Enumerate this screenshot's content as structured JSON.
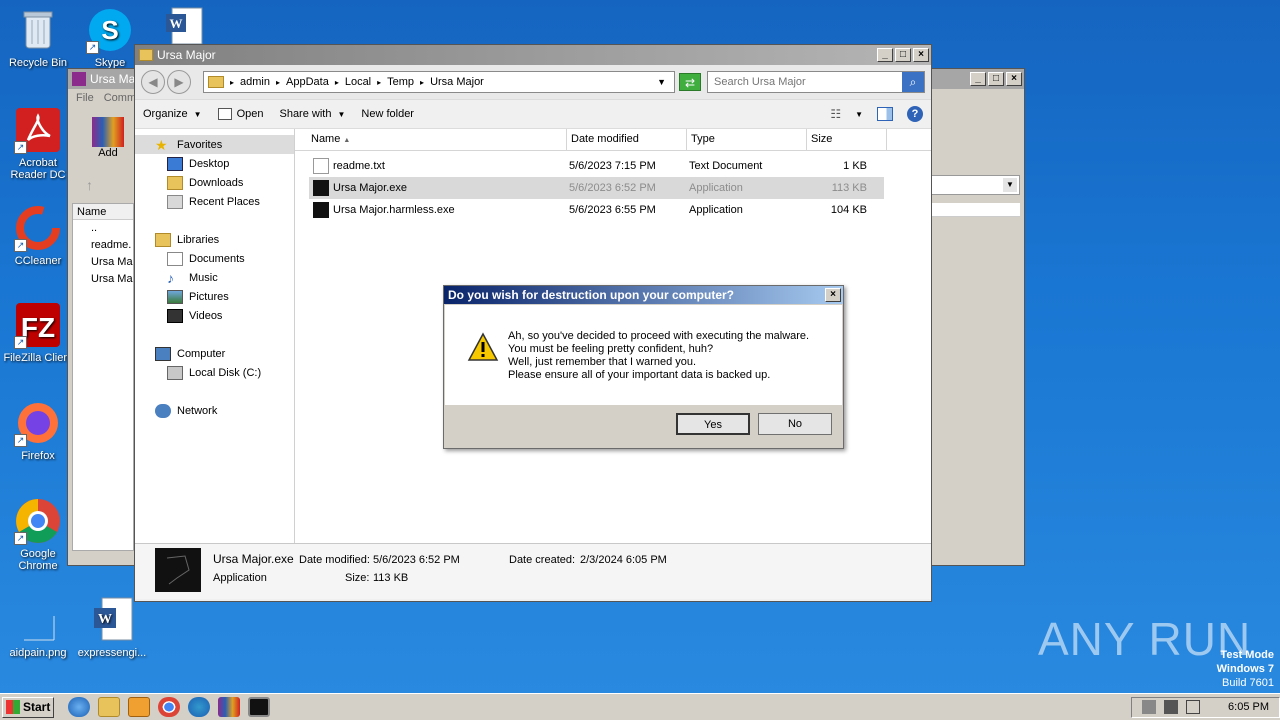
{
  "desktop_icons": [
    {
      "label": "Recycle Bin",
      "icon": "recycle-bin-icon"
    },
    {
      "label": "Skype",
      "icon": "skype-icon"
    },
    {
      "label": "Acrobat Reader DC",
      "icon": "acrobat-icon"
    },
    {
      "label": "CCleaner",
      "icon": "ccleaner-icon"
    },
    {
      "label": "FileZilla Client",
      "icon": "filezilla-icon"
    },
    {
      "label": "Firefox",
      "icon": "firefox-icon"
    },
    {
      "label": "Google Chrome",
      "icon": "chrome-icon"
    },
    {
      "label": "aidpain.png",
      "icon": "image-file-icon"
    },
    {
      "label": "expressengi...",
      "icon": "word-doc-icon"
    }
  ],
  "back_window": {
    "title": "Ursa Ma",
    "menu_file": "File",
    "menu_comm": "Comm",
    "add_label": "Add",
    "col_name": "Name",
    "rows": [
      "..",
      "readme.",
      "Ursa Ma",
      "Ursa Ma"
    ]
  },
  "explorer": {
    "title": "Ursa Major",
    "breadcrumb": [
      "admin",
      "AppData",
      "Local",
      "Temp",
      "Ursa Major"
    ],
    "search_placeholder": "Search Ursa Major",
    "toolbar": {
      "organize": "Organize",
      "open": "Open",
      "share_with": "Share with",
      "new_folder": "New folder"
    },
    "nav": {
      "favorites": "Favorites",
      "favorites_items": [
        "Desktop",
        "Downloads",
        "Recent Places"
      ],
      "libraries": "Libraries",
      "libraries_items": [
        "Documents",
        "Music",
        "Pictures",
        "Videos"
      ],
      "computer": "Computer",
      "computer_items": [
        "Local Disk (C:)"
      ],
      "network": "Network"
    },
    "columns": {
      "name": "Name",
      "date": "Date modified",
      "type": "Type",
      "size": "Size"
    },
    "files": [
      {
        "name": "readme.txt",
        "date": "5/6/2023 7:15 PM",
        "type": "Text Document",
        "size": "1 KB"
      },
      {
        "name": "Ursa Major.exe",
        "date": "5/6/2023 6:52 PM",
        "type": "Application",
        "size": "113 KB"
      },
      {
        "name": "Ursa Major.harmless.exe",
        "date": "5/6/2023 6:55 PM",
        "type": "Application",
        "size": "104 KB"
      }
    ],
    "details": {
      "filename": "Ursa Major.exe",
      "modified_label": "Date modified:",
      "modified": "5/6/2023 6:52 PM",
      "created_label": "Date created:",
      "created": "2/3/2024 6:05 PM",
      "type": "Application",
      "size_label": "Size:",
      "size": "113 KB"
    }
  },
  "dialog": {
    "title": "Do you wish for destruction upon your computer?",
    "lines": [
      "Ah, so you've decided to proceed with executing the malware.",
      "You must be feeling pretty confident, huh?",
      "Well, just remember that I warned you.",
      "Please ensure all of your important data is backed up."
    ],
    "yes": "Yes",
    "no": "No"
  },
  "taskbar": {
    "start": "Start",
    "clock": "6:05 PM"
  },
  "watermark": "ANY RUN",
  "test_mode": [
    "Test Mode",
    "Windows 7",
    "Build 7601"
  ]
}
